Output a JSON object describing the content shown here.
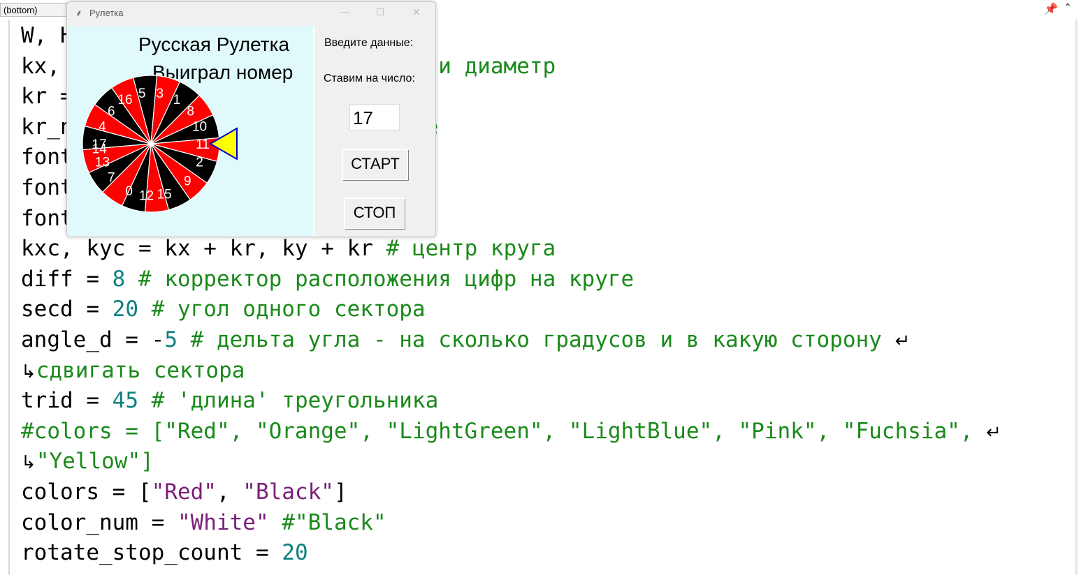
{
  "editor": {
    "combo_value": "(bottom)",
    "lines": [
      [
        {
          "t": "W, H",
          "c": ""
        }
      ],
      [
        {
          "t": "kx, ",
          "c": ""
        },
        {
          "t": "                    у круга и диаметр",
          "c": "cmt"
        }
      ],
      [
        {
          "t": "kr =",
          "c": ""
        }
      ],
      [
        {
          "t": "kr_n",
          "c": ""
        },
        {
          "t": "                  о на круге",
          "c": "cmt"
        }
      ],
      [
        {
          "t": "font",
          "c": ""
        }
      ],
      [
        {
          "t": "font",
          "c": ""
        }
      ],
      [
        {
          "t": "font",
          "c": ""
        }
      ],
      [
        {
          "t": "kxc, kyc = kx + kr, ky + kr ",
          "c": ""
        },
        {
          "t": "# центр круга",
          "c": "cmt"
        }
      ],
      [
        {
          "t": "diff = ",
          "c": ""
        },
        {
          "t": "8",
          "c": "num"
        },
        {
          "t": " # корректор расположения цифр на круге",
          "c": "cmt"
        }
      ],
      [
        {
          "t": "secd = ",
          "c": ""
        },
        {
          "t": "20",
          "c": "num"
        },
        {
          "t": " # угол одного сектора",
          "c": "cmt"
        }
      ],
      [
        {
          "t": "angle_d = -",
          "c": ""
        },
        {
          "t": "5",
          "c": "num"
        },
        {
          "t": " # дельта угла - на сколько градусов и в какую сторону ",
          "c": "cmt"
        },
        {
          "t": "↵",
          "c": "wrap"
        }
      ],
      [
        {
          "t": "↳",
          "c": "wrap"
        },
        {
          "t": "сдвигать сектора",
          "c": "cmt"
        }
      ],
      [
        {
          "t": "trid = ",
          "c": ""
        },
        {
          "t": "45",
          "c": "num"
        },
        {
          "t": " # 'длина' треугольника",
          "c": "cmt"
        }
      ],
      [
        {
          "t": "#colors = [\"Red\", \"Orange\", \"LightGreen\", \"LightBlue\", \"Pink\", \"Fuchsia\", ",
          "c": "cmt"
        },
        {
          "t": "↵",
          "c": "wrap"
        }
      ],
      [
        {
          "t": "↳",
          "c": "wrap"
        },
        {
          "t": "\"Yellow\"]",
          "c": "cmt"
        }
      ],
      [
        {
          "t": "colors = [",
          "c": ""
        },
        {
          "t": "\"Red\"",
          "c": "str"
        },
        {
          "t": ", ",
          "c": ""
        },
        {
          "t": "\"Black\"",
          "c": "str"
        },
        {
          "t": "]",
          "c": ""
        }
      ],
      [
        {
          "t": "color_num = ",
          "c": ""
        },
        {
          "t": "\"White\"",
          "c": "str"
        },
        {
          "t": " #\"Black\"",
          "c": "cmt"
        }
      ],
      [
        {
          "t": "rotate_stop_count = ",
          "c": ""
        },
        {
          "t": "20",
          "c": "num"
        }
      ]
    ]
  },
  "window": {
    "title": "Рулетка",
    "canvas_title_line1": "Русская Рулетка",
    "canvas_title_line2": "Выиграл номер",
    "label_enter": "Введите данные:",
    "label_bet": "Ставим на число:",
    "bet_value": "17",
    "start_label": "СТАРТ",
    "stop_label": "СТОП"
  },
  "wheel": {
    "sector_colors": [
      "#ff0000",
      "#000000"
    ],
    "number_color": "#ffffff",
    "pointer_color": "#ffff00",
    "pointer_outline": "#0000cc",
    "sectors": [
      {
        "n": "11",
        "a": 0
      },
      {
        "n": "8",
        "a": -40
      },
      {
        "n": "10",
        "a": -20
      },
      {
        "n": "1",
        "a": -60
      },
      {
        "n": "3",
        "a": -80
      },
      {
        "n": "5",
        "a": -100
      },
      {
        "n": "16",
        "a": -120
      },
      {
        "n": "6",
        "a": -140
      },
      {
        "n": "4",
        "a": -160
      },
      {
        "n": "14",
        "a": -185
      },
      {
        "n": "17",
        "a": 180
      },
      {
        "n": "13",
        "a": 160
      },
      {
        "n": "7",
        "a": 140
      },
      {
        "n": "0",
        "a": 115
      },
      {
        "n": "12",
        "a": 95
      },
      {
        "n": "15",
        "a": 75
      },
      {
        "n": "9",
        "a": 45
      },
      {
        "n": "2",
        "a": 20
      }
    ]
  }
}
